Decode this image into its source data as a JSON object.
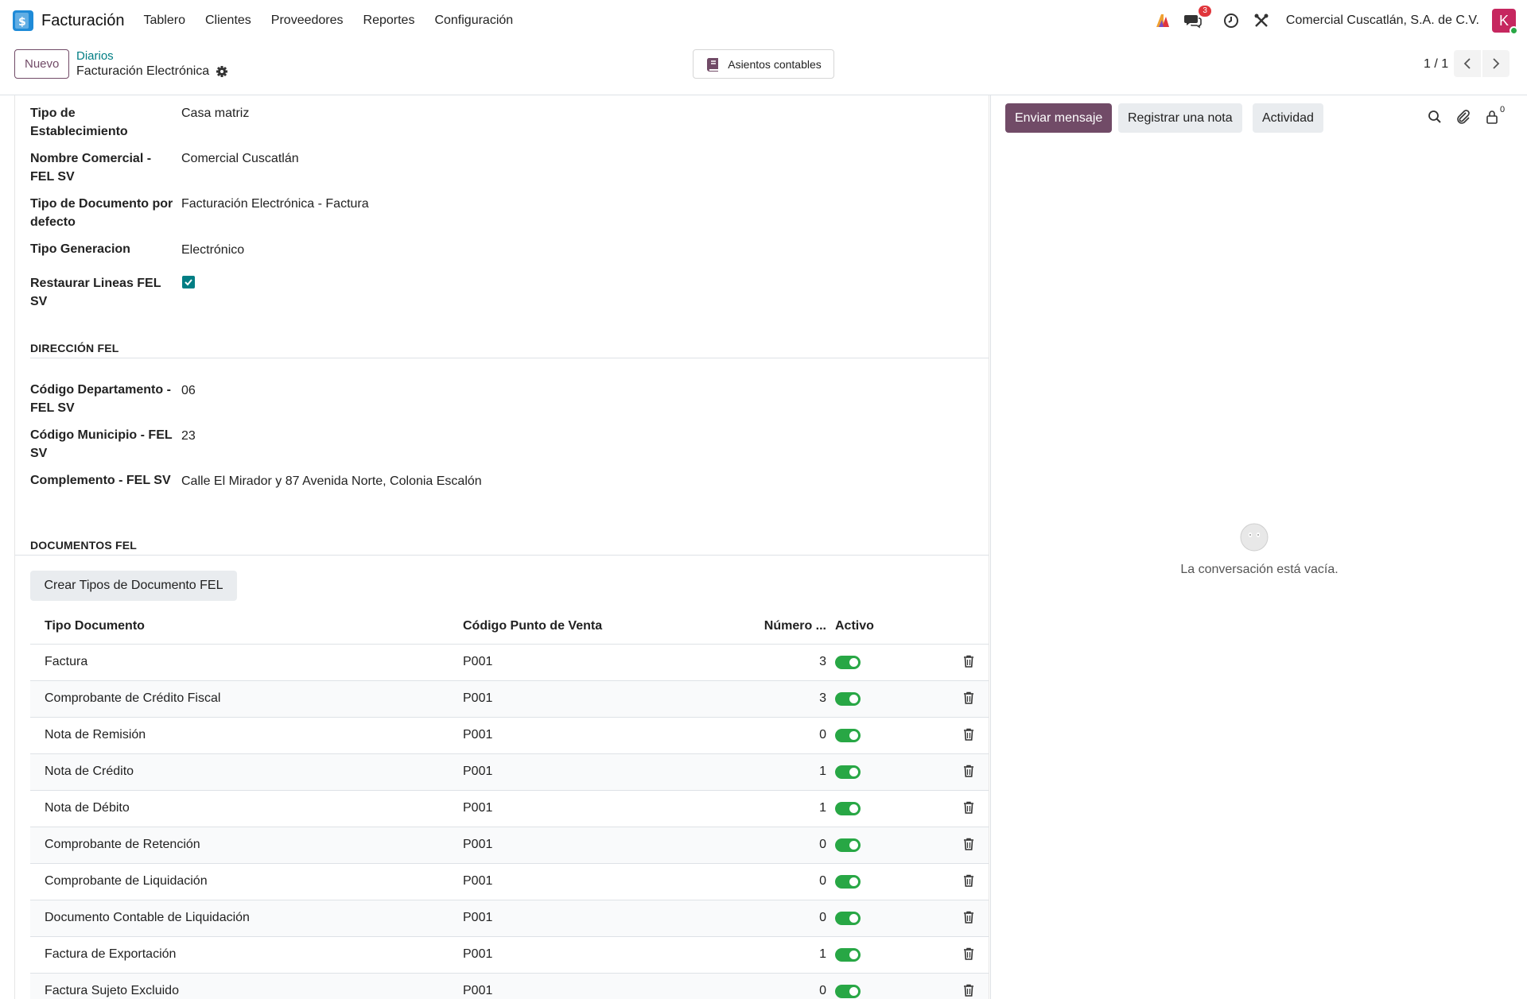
{
  "navbar": {
    "app_name": "Facturación",
    "menu": [
      "Tablero",
      "Clientes",
      "Proveedores",
      "Reportes",
      "Configuración"
    ],
    "messages_badge": "3",
    "company": "Comercial Cuscatlán, S.A. de C.V.",
    "avatar_letter": "K"
  },
  "control": {
    "new_label": "Nuevo",
    "breadcrumb_parent": "Diarios",
    "breadcrumb_current": "Facturación Electrónica",
    "smart_button_label": "Asientos contables",
    "pager": "1 / 1"
  },
  "form": {
    "fields_top": [
      {
        "label": "Tipo de Establecimiento",
        "value": "Casa matriz"
      },
      {
        "label": "Nombre Comercial - FEL SV",
        "value": "Comercial Cuscatlán"
      },
      {
        "label": "Tipo de Documento por defecto",
        "value": "Facturación Electrónica - Factura"
      },
      {
        "label": "Tipo Generacion",
        "value": "Electrónico"
      },
      {
        "label": "Restaurar Lineas FEL SV",
        "checked": true
      }
    ],
    "section_direccion": "DIRECCIÓN FEL",
    "fields_direccion": [
      {
        "label": "Código Departamento - FEL SV",
        "value": "06"
      },
      {
        "label": "Código Municipio - FEL SV",
        "value": "23"
      },
      {
        "label": "Complemento - FEL SV",
        "value": "Calle El Mirador y 87 Avenida Norte, Colonia Escalón"
      }
    ],
    "section_documentos": "DOCUMENTOS FEL",
    "crear_button": "Crear Tipos de Documento FEL",
    "table": {
      "headers": [
        "Tipo Documento",
        "Código Punto de Venta",
        "Número ...",
        "Activo"
      ],
      "rows": [
        {
          "tipo": "Factura",
          "codigo": "P001",
          "numero": "3",
          "activo": true
        },
        {
          "tipo": "Comprobante de Crédito Fiscal",
          "codigo": "P001",
          "numero": "3",
          "activo": true
        },
        {
          "tipo": "Nota de Remisión",
          "codigo": "P001",
          "numero": "0",
          "activo": true
        },
        {
          "tipo": "Nota de Crédito",
          "codigo": "P001",
          "numero": "1",
          "activo": true
        },
        {
          "tipo": "Nota de Débito",
          "codigo": "P001",
          "numero": "1",
          "activo": true
        },
        {
          "tipo": "Comprobante de Retención",
          "codigo": "P001",
          "numero": "0",
          "activo": true
        },
        {
          "tipo": "Comprobante de Liquidación",
          "codigo": "P001",
          "numero": "0",
          "activo": true
        },
        {
          "tipo": "Documento Contable de Liquidación",
          "codigo": "P001",
          "numero": "0",
          "activo": true
        },
        {
          "tipo": "Factura de Exportación",
          "codigo": "P001",
          "numero": "1",
          "activo": true
        },
        {
          "tipo": "Factura Sujeto Excluido",
          "codigo": "P001",
          "numero": "0",
          "activo": true
        }
      ]
    }
  },
  "chatter": {
    "send_label": "Enviar mensaje",
    "note_label": "Registrar una nota",
    "activity_label": "Actividad",
    "followers_count": "0",
    "empty_text": "La conversación está vacía."
  },
  "colors": {
    "primary": "#714b67",
    "link": "#017e84",
    "toggle_on": "#28a745",
    "badge": "#e0353b",
    "avatar": "#c6275f"
  }
}
